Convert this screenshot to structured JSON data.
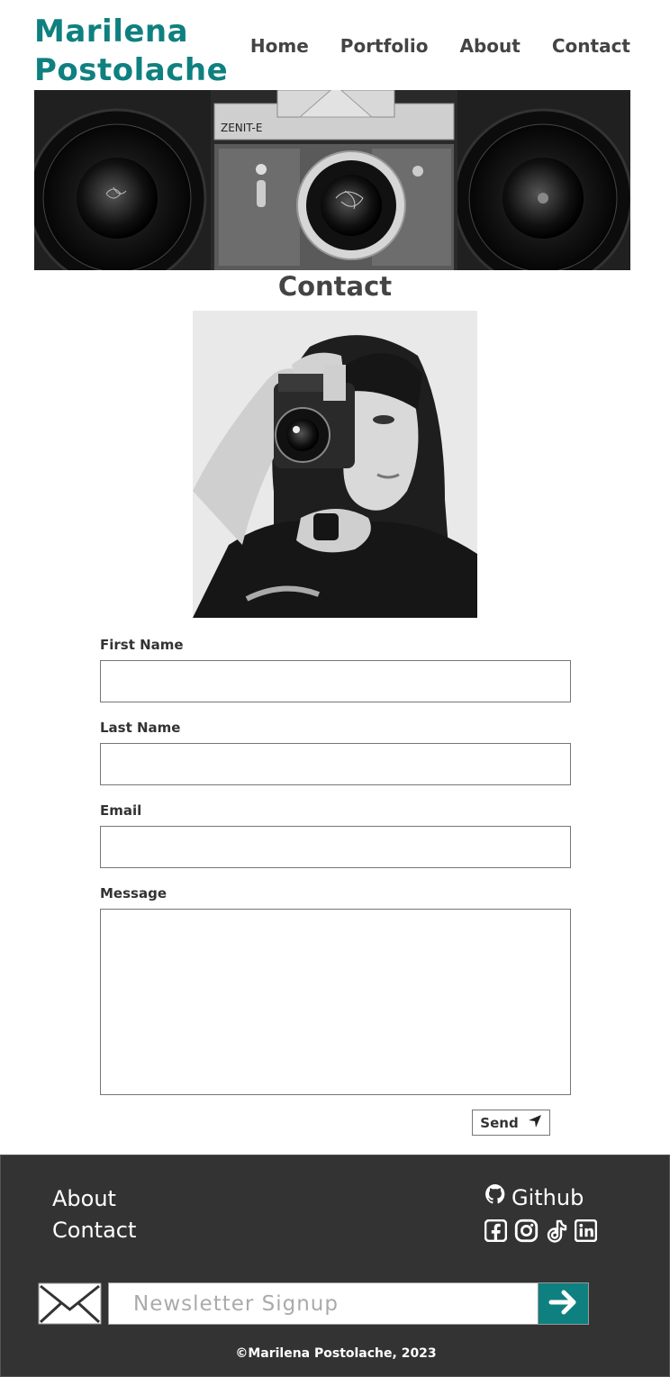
{
  "brand": {
    "line1": "Marilena",
    "line2": "Postolache",
    "color": "#0f8080"
  },
  "nav": {
    "items": [
      "Home",
      "Portfolio",
      "About",
      "Contact"
    ]
  },
  "banner": {
    "camera_brand": "ZENIT-E"
  },
  "main": {
    "title": "Contact"
  },
  "form": {
    "first_name_label": "First Name",
    "first_name_value": "",
    "last_name_label": "Last Name",
    "last_name_value": "",
    "email_label": "Email",
    "email_value": "",
    "message_label": "Message",
    "message_value": "",
    "send_label": "Send",
    "send_icon": "location-arrow-icon"
  },
  "footer": {
    "background": "#333333",
    "links": [
      "About",
      "Contact"
    ],
    "github_label": "Github",
    "social_icons": [
      "facebook-icon",
      "instagram-icon",
      "tiktok-icon",
      "linkedin-icon"
    ],
    "newsletter_placeholder": "Newsletter Signup",
    "newsletter_icon": "envelope-icon",
    "newsletter_submit_icon": "arrow-right-icon",
    "copyright": "©Marilena Postolache, 2023"
  }
}
